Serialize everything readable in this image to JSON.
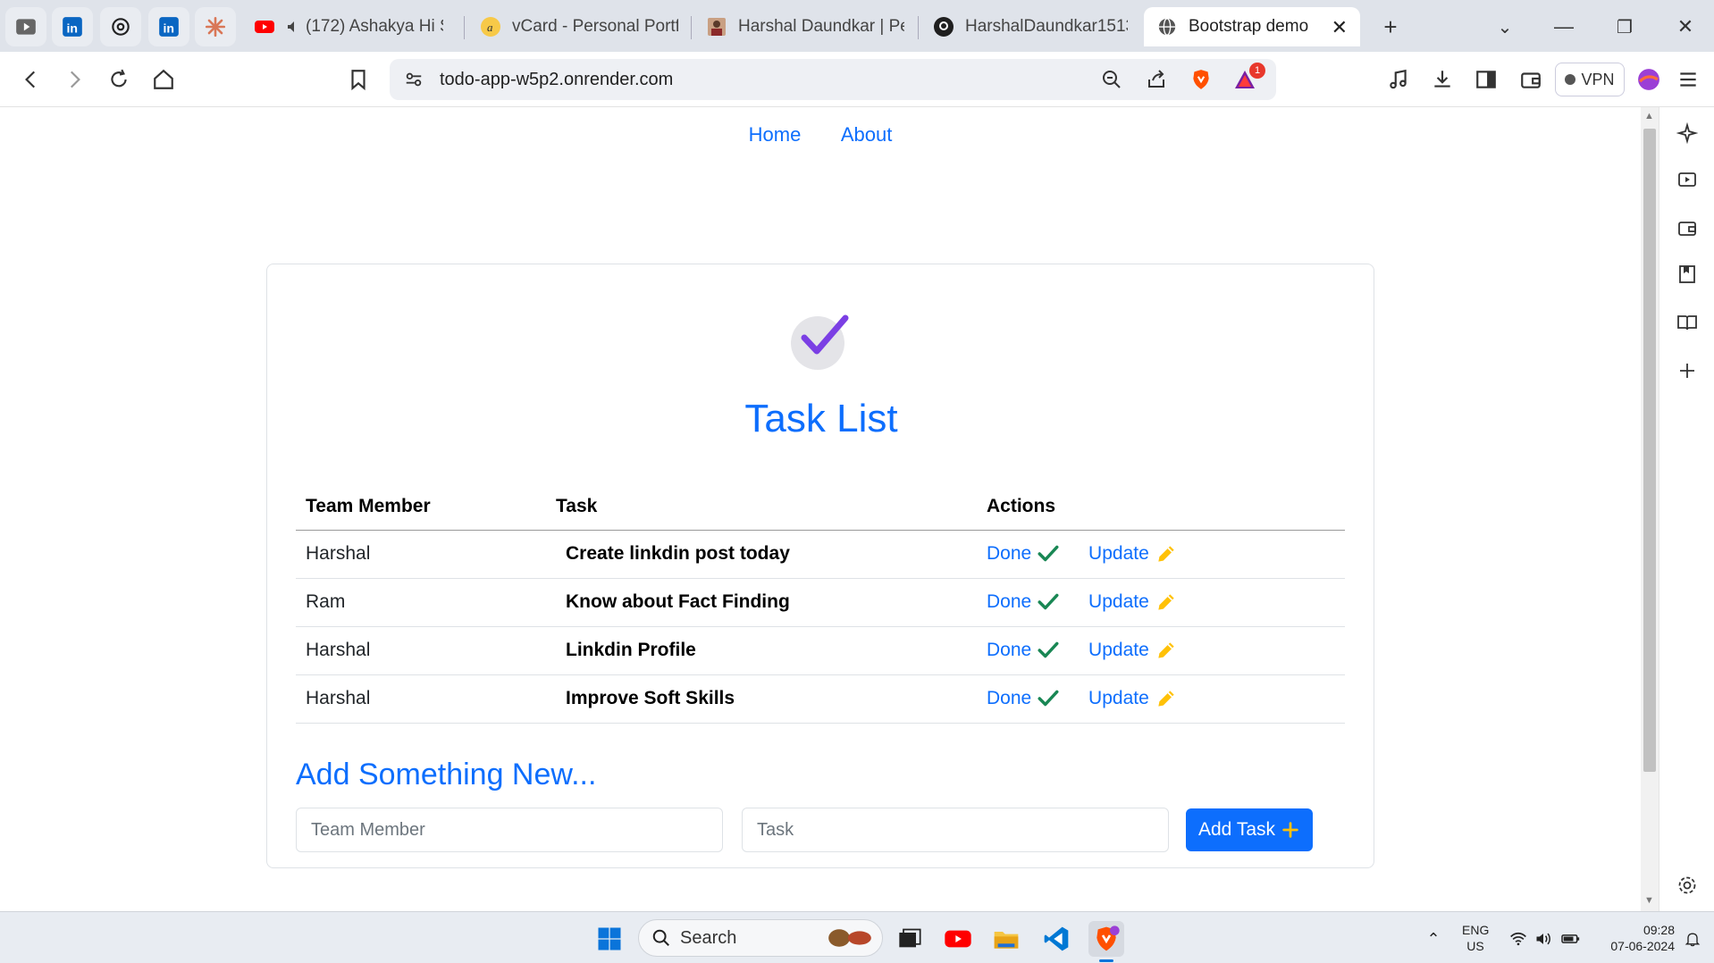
{
  "browser": {
    "tabs": [
      {
        "label": "(172) Ashakya Hi Sh",
        "icon": "youtube-icon"
      },
      {
        "label": "vCard - Personal Portfol",
        "icon": "vcard-icon"
      },
      {
        "label": "Harshal Daundkar | Pers",
        "icon": "profile-avatar-icon"
      },
      {
        "label": "HarshalDaundkar1513/",
        "icon": "github-icon"
      },
      {
        "label": "Bootstrap demo",
        "icon": "globe-icon",
        "active": true
      }
    ],
    "url": "todo-app-w5p2.onrender.com",
    "notification_count": "1",
    "vpn_label": "VPN"
  },
  "page": {
    "nav": {
      "home": "Home",
      "about": "About"
    },
    "title": "Task List",
    "table": {
      "headers": {
        "member": "Team Member",
        "task": "Task",
        "actions": "Actions"
      },
      "rows": [
        {
          "member": "Harshal",
          "task": "Create linkdin post today",
          "done": "Done",
          "update": "Update"
        },
        {
          "member": "Ram",
          "task": "Know about Fact Finding",
          "done": "Done",
          "update": "Update"
        },
        {
          "member": "Harshal",
          "task": "Linkdin Profile",
          "done": "Done",
          "update": "Update"
        },
        {
          "member": "Harshal",
          "task": "Improve Soft Skills",
          "done": "Done",
          "update": "Update"
        }
      ]
    },
    "add_section": {
      "heading": "Add Something New...",
      "member_placeholder": "Team Member",
      "task_placeholder": "Task",
      "button": "Add Task"
    },
    "colors": {
      "primary": "#0d6efd",
      "check": "#198754",
      "pencil": "#ffc107"
    }
  },
  "taskbar": {
    "search_label": "Search",
    "language": "ENG",
    "region": "US",
    "time": "09:28",
    "date": "07-06-2024"
  }
}
